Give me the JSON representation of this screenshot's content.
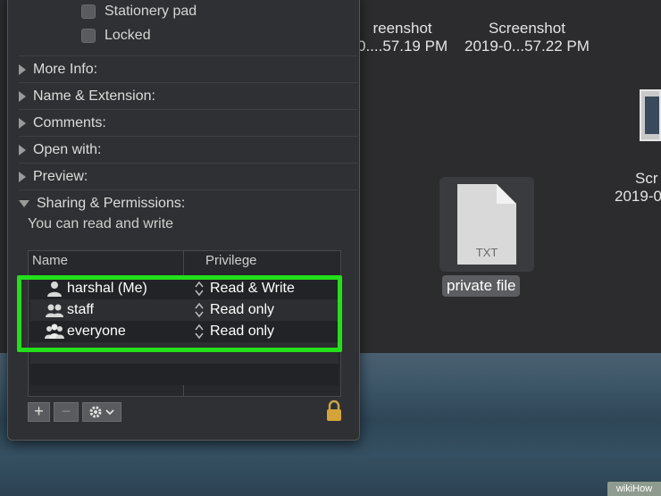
{
  "finder": {
    "files": [
      {
        "name": "reenshot",
        "sub": "0....57.19 PM"
      },
      {
        "name": "Screenshot",
        "sub": "2019-0...57.22 PM"
      },
      {
        "name": "Scr",
        "sub": "2019-0"
      }
    ],
    "selected_file": {
      "icon_text": "TXT",
      "name": "private file"
    }
  },
  "info": {
    "checkboxes": [
      "Stationery pad",
      "Locked"
    ],
    "sections": [
      "More Info:",
      "Name & Extension:",
      "Comments:",
      "Open with:",
      "Preview:",
      "Sharing & Permissions:"
    ],
    "permission_summary": "You can read and write",
    "table": {
      "headers": {
        "name": "Name",
        "privilege": "Privilege"
      },
      "rows": [
        {
          "user": "harshal (Me)",
          "privilege": "Read & Write",
          "icon": "single-user-icon"
        },
        {
          "user": "staff",
          "privilege": "Read only",
          "icon": "group-icon"
        },
        {
          "user": "everyone",
          "privilege": "Read only",
          "icon": "everyone-icon"
        }
      ]
    },
    "toolbar": {
      "add": "+",
      "remove": "−",
      "action_menu": "gear-icon"
    }
  },
  "highlight_color": "#23e01b",
  "watermark": "wikiHow"
}
